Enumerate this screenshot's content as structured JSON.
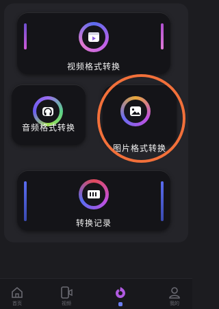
{
  "cards": {
    "video": {
      "label": "视频格式转换",
      "icon": "video-icon"
    },
    "audio": {
      "label": "音频格式转换",
      "icon": "headphones-icon"
    },
    "image": {
      "label": "图片格式转换",
      "icon": "image-icon"
    },
    "history": {
      "label": "转换记录",
      "icon": "history-icon"
    }
  },
  "tabbar": {
    "tabs": [
      {
        "label": "首页",
        "icon": "home-icon"
      },
      {
        "label": "视频",
        "icon": "phone-video-icon"
      },
      {
        "label": "",
        "icon": "convert-icon"
      },
      {
        "label": "我的",
        "icon": "user-icon"
      }
    ]
  },
  "colors": {
    "highlight": "#f2703a",
    "accent_purple": "#a35bf0",
    "accent_blue": "#4f6cf0"
  }
}
